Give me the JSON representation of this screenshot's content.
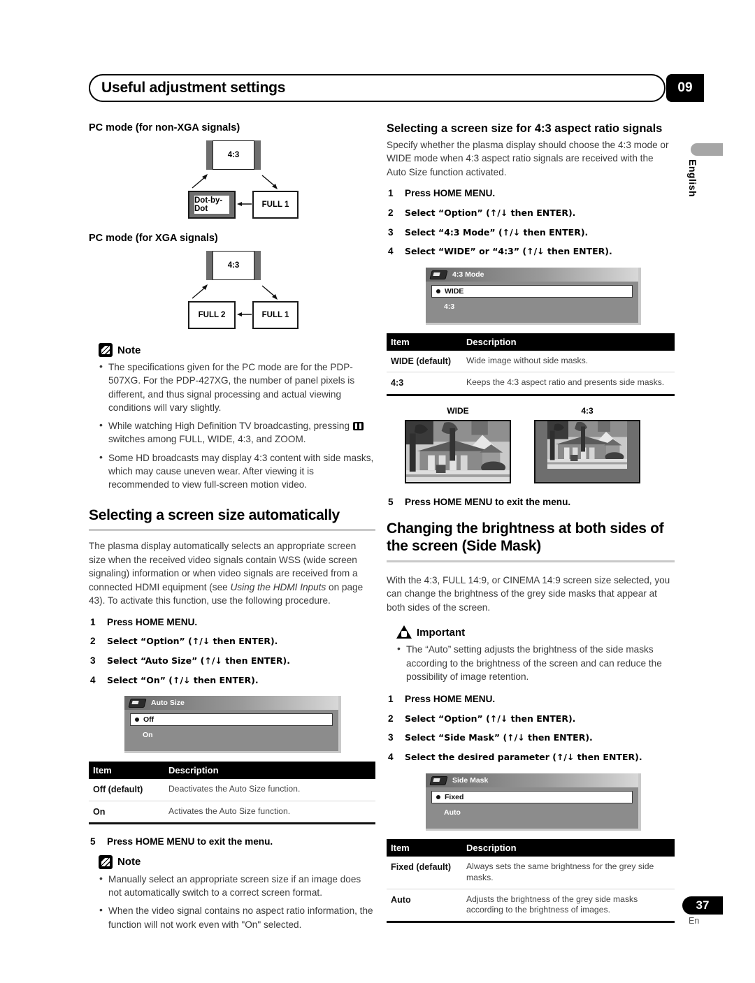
{
  "header": {
    "title": "Useful adjustment settings",
    "chapter": "09"
  },
  "margin": {
    "language": "English"
  },
  "left_column": {
    "pc_mode_nonxga_heading": "PC mode (for non-XGA signals)",
    "pc_mode_nonxga_flow": {
      "top": "4:3",
      "bottom_left": "Dot-by-Dot",
      "bottom_right": "FULL 1"
    },
    "pc_mode_xga_heading": "PC mode (for XGA signals)",
    "pc_mode_xga_flow": {
      "top": "4:3",
      "bottom_left": "FULL 2",
      "bottom_right": "FULL 1"
    },
    "note1": {
      "label": "Note",
      "bullets": [
        "The specifications given for the PC mode are for the PDP-507XG. For the PDP-427XG, the number of panel pixels is different, and thus signal processing and actual viewing conditions will vary slightly.",
        "While watching High Definition TV broadcasting, pressing ",
        "Some HD broadcasts may display 4:3 content with side masks, which may cause uneven wear. After viewing it is recommended to view full-screen motion video."
      ],
      "bullet2_tail": "switches among FULL, WIDE, 4:3, and ZOOM."
    },
    "auto_section": {
      "title": "Selecting a screen size automatically",
      "intro_a": "The plasma display automatically selects an appropriate screen size when the received video signals contain WSS (wide screen signaling) information or when video signals are received from a connected HDMI equipment (see ",
      "intro_italic": "Using the HDMI Inputs",
      "intro_b": " on page 43). To activate this function, use the following procedure.",
      "steps": [
        {
          "num": "1",
          "text": "Press HOME MENU."
        },
        {
          "num": "2",
          "text": "Select “Option” (↑/↓ then ENTER)."
        },
        {
          "num": "3",
          "text": "Select “Auto Size” (↑/↓ then ENTER)."
        },
        {
          "num": "4",
          "text": "Select “On” (↑/↓ then ENTER)."
        }
      ],
      "osd": {
        "title": "Auto Size",
        "rows": [
          {
            "label": "Off",
            "selected": true
          },
          {
            "label": "On",
            "selected": false
          }
        ]
      },
      "table": {
        "headers": [
          "Item",
          "Description"
        ],
        "rows": [
          [
            "Off (default)",
            "Deactivates the Auto Size function."
          ],
          [
            "On",
            "Activates the Auto Size function."
          ]
        ]
      },
      "step5": {
        "num": "5",
        "text": "Press HOME MENU to exit the menu."
      }
    },
    "note2": {
      "label": "Note",
      "bullets": [
        "Manually select an appropriate screen size if an image does not automatically switch to a correct screen format.",
        "When the video signal contains no aspect ratio information, the function will not work even with \"On\" selected."
      ]
    }
  },
  "right_column": {
    "ratio_section": {
      "title": "Selecting a screen size for 4:3 aspect ratio signals",
      "intro": "Specify whether the plasma display should choose the 4:3 mode or WIDE mode when 4:3 aspect ratio signals are received with the Auto Size function activated.",
      "steps": [
        {
          "num": "1",
          "text": "Press HOME MENU."
        },
        {
          "num": "2",
          "text": "Select “Option” (↑/↓ then ENTER)."
        },
        {
          "num": "3",
          "text": "Select “4:3 Mode” (↑/↓ then ENTER)."
        },
        {
          "num": "4",
          "text": "Select “WIDE” or “4:3” (↑/↓ then ENTER)."
        }
      ],
      "osd": {
        "title": "4:3 Mode",
        "rows": [
          {
            "label": "WIDE",
            "selected": true
          },
          {
            "label": "4:3",
            "selected": false
          }
        ]
      },
      "table": {
        "headers": [
          "Item",
          "Description"
        ],
        "rows": [
          [
            "WIDE (default)",
            "Wide image without side masks."
          ],
          [
            "4:3",
            "Keeps the 4:3 aspect ratio and presents side masks."
          ]
        ]
      },
      "photos": [
        {
          "caption": "WIDE"
        },
        {
          "caption": "4:3"
        }
      ],
      "step5": {
        "num": "5",
        "text": "Press HOME MENU to exit the menu."
      }
    },
    "sidemask_section": {
      "title": "Changing the brightness at both sides of the screen (Side Mask)",
      "intro": "With the 4:3, FULL 14:9, or CINEMA 14:9 screen size selected, you can change the brightness of the grey side masks that appear at both sides of the screen.",
      "important": {
        "label": "Important",
        "bullets": [
          "The “Auto” setting adjusts the brightness of the side masks according to the brightness of the screen and can reduce the possibility of image retention."
        ]
      },
      "steps": [
        {
          "num": "1",
          "text": "Press HOME MENU."
        },
        {
          "num": "2",
          "text": "Select “Option” (↑/↓ then ENTER)."
        },
        {
          "num": "3",
          "text": "Select “Side Mask” (↑/↓ then ENTER)."
        },
        {
          "num": "4",
          "text": "Select the desired parameter (↑/↓ then ENTER)."
        }
      ],
      "osd": {
        "title": "Side Mask",
        "rows": [
          {
            "label": "Fixed",
            "selected": true
          },
          {
            "label": "Auto",
            "selected": false
          }
        ]
      },
      "table": {
        "headers": [
          "Item",
          "Description"
        ],
        "rows": [
          [
            "Fixed (default)",
            "Always sets the same brightness for the grey side masks."
          ],
          [
            "Auto",
            "Adjusts the brightness of the grey side masks according to the brightness of images."
          ]
        ]
      }
    }
  },
  "footer": {
    "page_number": "37",
    "language_code": "En"
  }
}
